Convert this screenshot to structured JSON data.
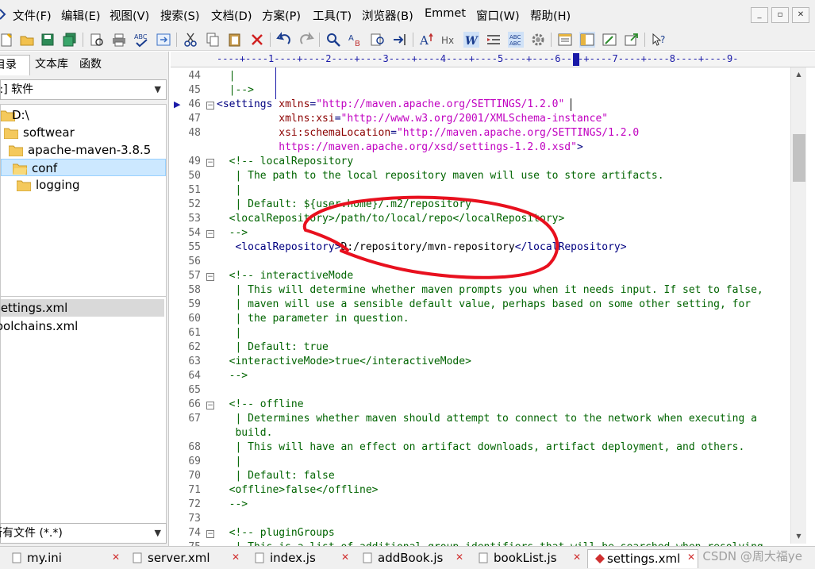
{
  "menu": {
    "items": [
      "文件(F)",
      "编辑(E)",
      "视图(V)",
      "搜索(S)",
      "文档(D)",
      "方案(P)",
      "工具(T)",
      "浏览器(B)",
      "Emmet",
      "窗口(W)",
      "帮助(H)"
    ],
    "window_controls": [
      "_",
      "▫",
      "✕"
    ]
  },
  "toolbar": {
    "icons": [
      "new-file-icon",
      "open-folder-icon",
      "save-icon",
      "save-all-icon",
      "print-preview-icon",
      "print-icon",
      "spellcheck-icon",
      "sync-icon",
      "cut-icon",
      "copy-icon",
      "paste-icon",
      "delete-icon",
      "undo-icon",
      "redo-icon",
      "find-icon",
      "replace-icon",
      "find-files-icon",
      "goto-icon",
      "font-size-icon",
      "heading-icon",
      "word-wrap-icon",
      "indent-icon",
      "column-mode-icon",
      "settings-icon",
      "panel-icon",
      "split-view-icon",
      "browser-preview-icon",
      "external-icon",
      "help-icon"
    ]
  },
  "left_panel": {
    "tabs": [
      "目录",
      "文本库",
      "函数"
    ],
    "drive_combo": "[-:] 软件",
    "tree": [
      {
        "label": "D:\\",
        "indent": 0
      },
      {
        "label": "softwear",
        "indent": 1
      },
      {
        "label": "apache-maven-3.8.5",
        "indent": 2
      },
      {
        "label": "conf",
        "indent": 3,
        "selected": true
      },
      {
        "label": "logging",
        "indent": 4
      }
    ],
    "files": [
      "settings.xml",
      "toolchains.xml"
    ],
    "filter_combo": "所有文件 (*.*)"
  },
  "editor": {
    "ruler": "----+----1----+----2----+----3----+----4----+----5----+----6----+----7----+----8----+----9-",
    "lines": [
      {
        "n": "44",
        "segs": [
          [
            "com",
            "  |"
          ]
        ]
      },
      {
        "n": "45",
        "segs": [
          [
            "com",
            "  |-->"
          ]
        ]
      },
      {
        "n": "46",
        "fold": true,
        "marker": true,
        "segs": [
          [
            "tag",
            "<settings "
          ],
          [
            "attr",
            "xmlns"
          ],
          [
            "tag",
            "="
          ],
          [
            "str",
            "\"http://maven.apache.org/SETTINGS/1.2.0\""
          ]
        ]
      },
      {
        "n": "47",
        "segs": [
          [
            "attr",
            "          xmlns:xsi"
          ],
          [
            "tag",
            "="
          ],
          [
            "str",
            "\"http://www.w3.org/2001/XMLSchema-instance\""
          ]
        ]
      },
      {
        "n": "48",
        "segs": [
          [
            "attr",
            "          xsi:schemaLocation"
          ],
          [
            "tag",
            "="
          ],
          [
            "str",
            "\"http://maven.apache.org/SETTINGS/1.2.0"
          ]
        ]
      },
      {
        "n": "",
        "segs": [
          [
            "str",
            "          https://maven.apache.org/xsd/settings-1.2.0.xsd\""
          ],
          [
            "tag",
            ">"
          ]
        ]
      },
      {
        "n": "49",
        "fold": true,
        "segs": [
          [
            "com",
            "  <!-- localRepository"
          ]
        ]
      },
      {
        "n": "50",
        "segs": [
          [
            "com",
            "   | The path to the local repository maven will use to store artifacts."
          ]
        ]
      },
      {
        "n": "51",
        "segs": [
          [
            "com",
            "   |"
          ]
        ]
      },
      {
        "n": "52",
        "segs": [
          [
            "com",
            "   | Default: ${user.home}/.m2/repository"
          ]
        ]
      },
      {
        "n": "53",
        "segs": [
          [
            "com",
            "  <localRepository>/path/to/local/repo</localRepository>"
          ]
        ]
      },
      {
        "n": "54",
        "fold": true,
        "segs": [
          [
            "com",
            "  -->"
          ]
        ]
      },
      {
        "n": "55",
        "segs": [
          [
            "tag",
            "   <localRepository>"
          ],
          [
            "txt",
            "D:/repository/mvn-repository"
          ],
          [
            "tag",
            "</localRepository>"
          ]
        ]
      },
      {
        "n": "56",
        "segs": [
          [
            "com",
            ""
          ]
        ]
      },
      {
        "n": "57",
        "fold": true,
        "segs": [
          [
            "com",
            "  <!-- interactiveMode"
          ]
        ]
      },
      {
        "n": "58",
        "segs": [
          [
            "com",
            "   | This will determine whether maven prompts you when it needs input. If set to false,"
          ]
        ]
      },
      {
        "n": "59",
        "segs": [
          [
            "com",
            "   | maven will use a sensible default value, perhaps based on some other setting, for"
          ]
        ]
      },
      {
        "n": "60",
        "segs": [
          [
            "com",
            "   | the parameter in question."
          ]
        ]
      },
      {
        "n": "61",
        "segs": [
          [
            "com",
            "   |"
          ]
        ]
      },
      {
        "n": "62",
        "segs": [
          [
            "com",
            "   | Default: true"
          ]
        ]
      },
      {
        "n": "63",
        "segs": [
          [
            "com",
            "  <interactiveMode>true</interactiveMode>"
          ]
        ]
      },
      {
        "n": "64",
        "segs": [
          [
            "com",
            "  -->"
          ]
        ]
      },
      {
        "n": "65",
        "segs": [
          [
            "com",
            ""
          ]
        ]
      },
      {
        "n": "66",
        "fold": true,
        "segs": [
          [
            "com",
            "  <!-- offline"
          ]
        ]
      },
      {
        "n": "67",
        "segs": [
          [
            "com",
            "   | Determines whether maven should attempt to connect to the network when executing a"
          ]
        ]
      },
      {
        "n": "",
        "segs": [
          [
            "com",
            "   build."
          ]
        ]
      },
      {
        "n": "68",
        "segs": [
          [
            "com",
            "   | This will have an effect on artifact downloads, artifact deployment, and others."
          ]
        ]
      },
      {
        "n": "69",
        "segs": [
          [
            "com",
            "   |"
          ]
        ]
      },
      {
        "n": "70",
        "segs": [
          [
            "com",
            "   | Default: false"
          ]
        ]
      },
      {
        "n": "71",
        "segs": [
          [
            "com",
            "  <offline>false</offline>"
          ]
        ]
      },
      {
        "n": "72",
        "segs": [
          [
            "com",
            "  -->"
          ]
        ]
      },
      {
        "n": "73",
        "segs": [
          [
            "com",
            ""
          ]
        ]
      },
      {
        "n": "74",
        "fold": true,
        "segs": [
          [
            "com",
            "  <!-- pluginGroups"
          ]
        ]
      },
      {
        "n": "75",
        "segs": [
          [
            "com",
            "   | This is a list of additional group identifiers that will be searched when resolving"
          ]
        ]
      }
    ]
  },
  "tabs": [
    {
      "label": "my.ini",
      "active": false
    },
    {
      "label": "server.xml",
      "active": false
    },
    {
      "label": "index.js",
      "active": false
    },
    {
      "label": "addBook.js",
      "active": false
    },
    {
      "label": "bookList.js",
      "active": false
    },
    {
      "label": "settings.xml",
      "active": true
    }
  ],
  "watermark": "CSDN @周大福ye",
  "colors": {
    "annotation": "#e8101e",
    "tag": "#000080",
    "attr": "#8b0000",
    "string": "#c000c0",
    "comment": "#006400"
  }
}
